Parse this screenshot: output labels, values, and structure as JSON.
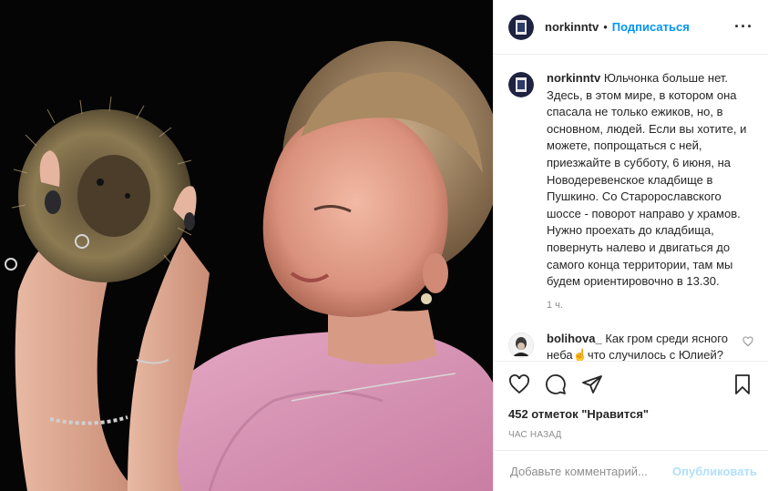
{
  "post": {
    "photo": {
      "description_icon": "photo-woman-hedgehog"
    },
    "author": {
      "username": "norkinntv",
      "follow_label": "Подписаться",
      "more_icon": "more-dots-icon"
    },
    "caption": {
      "username": "norkinntv",
      "text": "Юльчонка больше нет. Здесь, в этом мире, в котором она спасала не только ежиков, но, в основном, людей. Если вы хотите, и можете, попрощаться с ней, приезжайте в субботу, 6 июня, на Новодеревенское кладбище в Пушкино. Со Старорославского шоссе - поворот направо у храмов. Нужно проехать до кладбища, повернуть налево и двигаться до самого конца территории, там мы будем ориентировочно в 13.30.",
      "time": "1 ч."
    },
    "comments": [
      {
        "username": "bolihova_",
        "text_before": "Как гром среди ясного неба",
        "emoji_hand": "☝",
        "text_after": "что случилось с Юлией?",
        "roses": "🌹🌹🌹🌹🌹"
      }
    ],
    "likes": "452 отметок \"Нравится\"",
    "timestamp": "час назад",
    "add_comment": {
      "placeholder": "Добавьте комментарий...",
      "publish_label": "Опубликовать"
    },
    "colors": {
      "accent": "#0095f6",
      "publish_disabled": "#b2dffc",
      "border": "#efefef",
      "muted": "#8e8e8e"
    }
  }
}
